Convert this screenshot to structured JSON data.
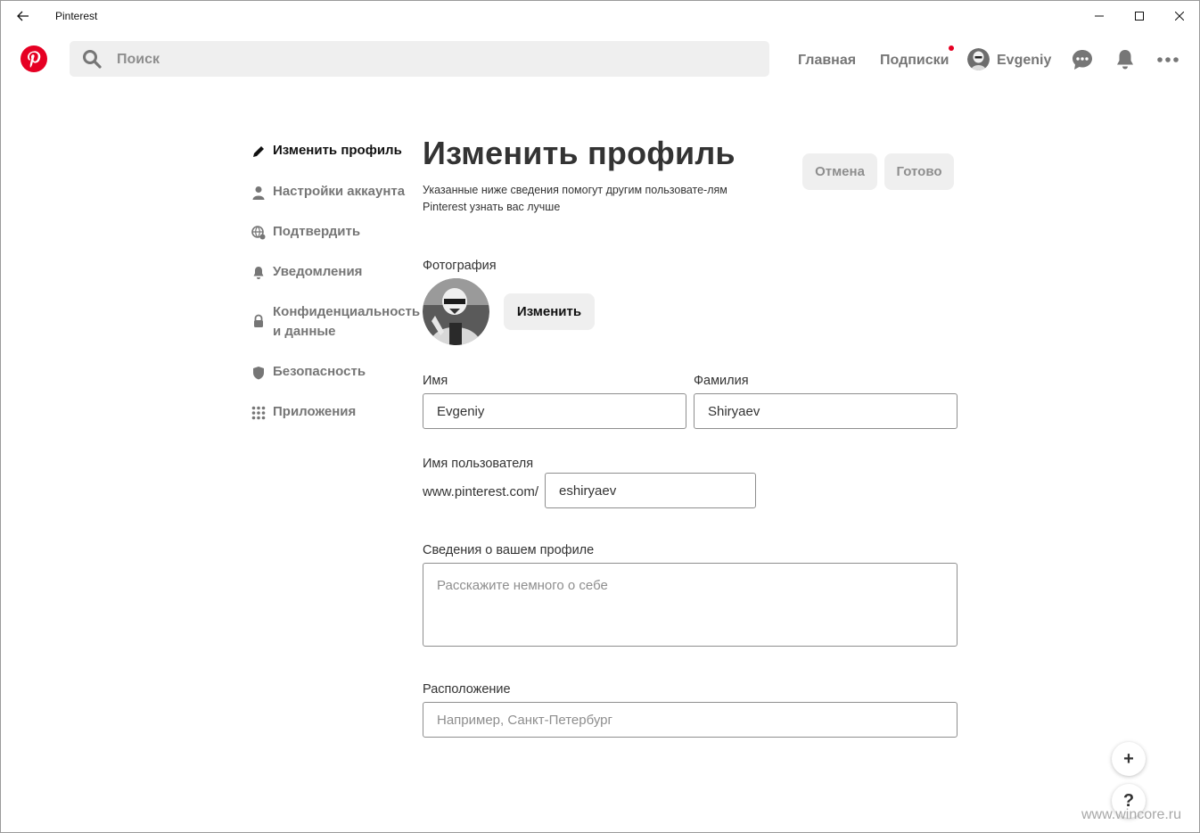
{
  "window": {
    "title": "Pinterest"
  },
  "header": {
    "search_placeholder": "Поиск",
    "nav_home": "Главная",
    "nav_subscriptions": "Подписки",
    "user_name": "Evgeniy",
    "brand_color": "#e60023"
  },
  "sidebar": {
    "items": [
      {
        "label": "Изменить профиль",
        "icon": "pencil-icon"
      },
      {
        "label": "Настройки аккаунта",
        "icon": "person-icon"
      },
      {
        "label": "Подтвердить",
        "icon": "globe-icon"
      },
      {
        "label": "Уведомления",
        "icon": "bell-icon"
      },
      {
        "label": "Конфиденциальность",
        "label2": "и данные",
        "icon": "lock-icon"
      },
      {
        "label": "Безопасность",
        "icon": "shield-icon"
      },
      {
        "label": "Приложения",
        "icon": "apps-grid-icon"
      }
    ]
  },
  "main": {
    "title": "Изменить профиль",
    "description": "Указанные ниже сведения помогут другим пользовате-лям Pinterest узнать вас лучше",
    "cancel_label": "Отмена",
    "done_label": "Готово",
    "photo_label": "Фотография",
    "change_label": "Изменить",
    "first_name_label": "Имя",
    "first_name_value": "Evgeniy",
    "last_name_label": "Фамилия",
    "last_name_value": "Shiryaev",
    "username_label": "Имя пользователя",
    "username_prefix": "www.pinterest.com/",
    "username_value": "eshiryaev",
    "about_label": "Сведения о вашем профиле",
    "about_placeholder": "Расскажите немного о себе",
    "location_label": "Расположение",
    "location_placeholder": "Например, Санкт-Петербург"
  },
  "fab": {
    "plus": "+",
    "help": "?"
  },
  "watermark": "www.wincore.ru"
}
